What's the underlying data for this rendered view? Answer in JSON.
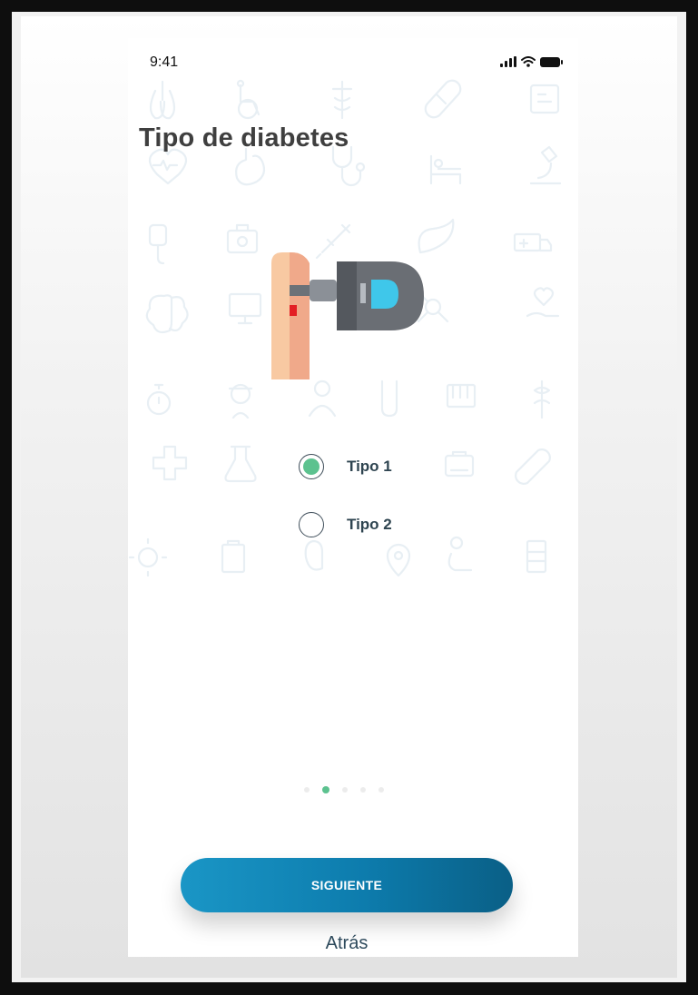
{
  "status_bar": {
    "time": "9:41"
  },
  "page": {
    "title": "Tipo de diabetes"
  },
  "illustration": {
    "name": "glucometer-finger-illustration"
  },
  "options": [
    {
      "label": "Tipo 1",
      "selected": true
    },
    {
      "label": "Tipo 2",
      "selected": false
    }
  ],
  "pagination": {
    "count": 5,
    "active_index": 1
  },
  "buttons": {
    "next_label": "SIGUIENTE",
    "back_label": "Atrás"
  },
  "colors": {
    "accent_green": "#5cc28f",
    "button_blue_start": "#1a96c6",
    "button_blue_end": "#0a5f86",
    "text_dark": "#3f3f3f",
    "label_color": "#2e4450"
  }
}
